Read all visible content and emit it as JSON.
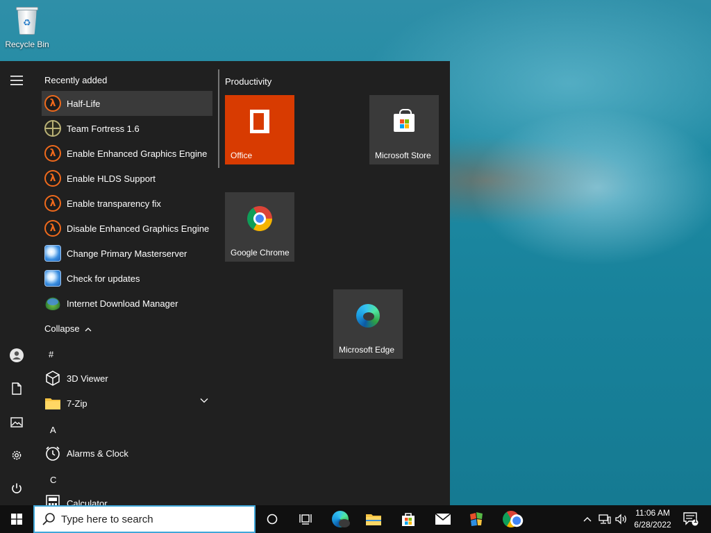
{
  "desktop": {
    "icons": [
      {
        "label": "Recycle Bin",
        "icon": "recycle-bin-icon"
      }
    ]
  },
  "start_menu": {
    "rail": {
      "menu_icon": "hamburger-icon",
      "user_icon": "user-icon",
      "documents_icon": "document-icon",
      "pictures_icon": "pictures-icon",
      "settings_icon": "gear-icon",
      "power_icon": "power-icon"
    },
    "recently_added_title": "Recently added",
    "recent_apps": [
      {
        "label": "Half-Life",
        "icon": "half-life-icon"
      },
      {
        "label": "Team Fortress 1.6",
        "icon": "team-fortress-icon"
      },
      {
        "label": "Enable Enhanced Graphics Engine",
        "icon": "half-life-icon"
      },
      {
        "label": "Enable HLDS Support",
        "icon": "half-life-icon"
      },
      {
        "label": "Enable transparency fix",
        "icon": "half-life-icon"
      },
      {
        "label": "Disable Enhanced Graphics Engine",
        "icon": "half-life-icon"
      },
      {
        "label": "Change Primary Masterserver",
        "icon": "globe-icon"
      },
      {
        "label": "Check for updates",
        "icon": "globe-icon"
      },
      {
        "label": "Internet Download Manager",
        "icon": "idm-icon"
      }
    ],
    "collapse_label": "Collapse",
    "groups": [
      {
        "letter": "#",
        "apps": [
          {
            "label": "3D Viewer",
            "icon": "cube-icon"
          },
          {
            "label": "7-Zip",
            "icon": "folder-icon",
            "expandable": true
          }
        ]
      },
      {
        "letter": "A",
        "apps": [
          {
            "label": "Alarms & Clock",
            "icon": "alarm-clock-icon"
          }
        ]
      },
      {
        "letter": "C",
        "apps": [
          {
            "label": "Calculator",
            "icon": "calculator-icon"
          }
        ]
      }
    ],
    "tiles_group_title": "Productivity",
    "tiles": [
      {
        "label": "Office",
        "icon": "office-icon",
        "color": "#d83b01"
      },
      {
        "label": "Microsoft Store",
        "icon": "store-icon"
      },
      {
        "label": "Google Chrome",
        "icon": "chrome-icon"
      },
      {
        "label": "Microsoft Edge",
        "icon": "edge-icon"
      }
    ]
  },
  "taskbar": {
    "start_icon": "windows-logo-icon",
    "search_placeholder": "Type here to search",
    "pinned": [
      {
        "name": "cortana",
        "icon": "cortana-circle-icon"
      },
      {
        "name": "task-view",
        "icon": "task-view-icon"
      },
      {
        "name": "edge",
        "icon": "edge-icon"
      },
      {
        "name": "file-explorer",
        "icon": "folder-icon"
      },
      {
        "name": "microsoft-store",
        "icon": "store-icon"
      },
      {
        "name": "mail",
        "icon": "mail-icon"
      },
      {
        "name": "half-life",
        "icon": "half-life-app-icon"
      },
      {
        "name": "chrome",
        "icon": "chrome-icon"
      }
    ],
    "tray": {
      "chevron_icon": "chevron-up-icon",
      "network_icon": "network-icon",
      "volume_icon": "volume-icon",
      "time": "11:06 AM",
      "date": "6/28/2022",
      "notification_count": "1"
    }
  },
  "colors": {
    "start_bg": "#202020",
    "taskbar_bg": "#101010",
    "office_tile": "#d83b01",
    "search_border": "#3fa7d9"
  }
}
